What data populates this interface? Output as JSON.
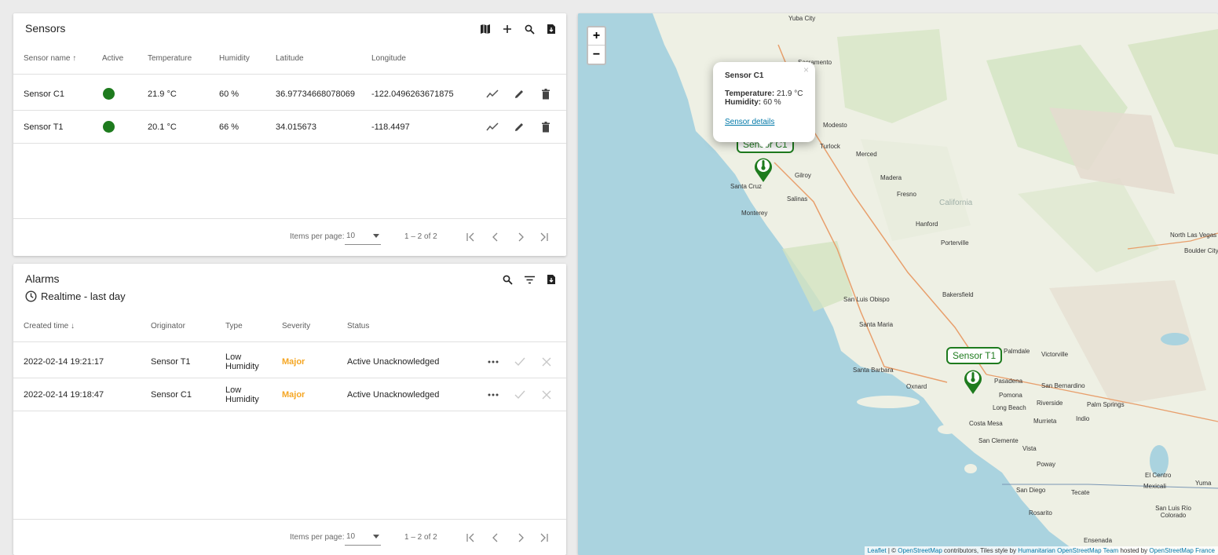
{
  "sensors": {
    "title": "Sensors",
    "toolbar_icons": [
      "map-icon",
      "add-icon",
      "search-icon",
      "export-icon"
    ],
    "columns": [
      "Sensor name",
      "Active",
      "Temperature",
      "Humidity",
      "Latitude",
      "Longitude"
    ],
    "sort_indicator": "↑",
    "rows": [
      {
        "name": "Sensor C1",
        "active": true,
        "temperature": "21.9 °C",
        "humidity": "60 %",
        "latitude": "36.97734668078069",
        "longitude": "-122.0496263671875"
      },
      {
        "name": "Sensor T1",
        "active": true,
        "temperature": "20.1 °C",
        "humidity": "66 %",
        "latitude": "34.015673",
        "longitude": "-118.4497"
      }
    ],
    "paginator": {
      "label": "Items per page:",
      "page_size": "10",
      "range": "1 – 2 of 2"
    }
  },
  "alarms": {
    "title": "Alarms",
    "timewindow": "Realtime - last day",
    "columns": [
      "Created time",
      "Originator",
      "Type",
      "Severity",
      "Status"
    ],
    "sort_indicator": "↓",
    "rows": [
      {
        "created": "2022-02-14 19:21:17",
        "originator": "Sensor T1",
        "type_line1": "Low",
        "type_line2": "Humidity",
        "severity": "Major",
        "status": "Active Unacknowledged"
      },
      {
        "created": "2022-02-14 19:18:47",
        "originator": "Sensor C1",
        "type_line1": "Low",
        "type_line2": "Humidity",
        "severity": "Major",
        "status": "Active Unacknowledged"
      }
    ],
    "paginator": {
      "label": "Items per page:",
      "page_size": "10",
      "range": "1 – 2 of 2"
    }
  },
  "map": {
    "zoom_in": "+",
    "zoom_out": "−",
    "popup": {
      "title": "Sensor C1",
      "temperature_label": "Temperature:",
      "temperature_value": "21.9 °C",
      "humidity_label": "Humidity:",
      "humidity_value": "60 %",
      "link": "Sensor details",
      "close": "×"
    },
    "markers": [
      {
        "label": "Sensor C1"
      },
      {
        "label": "Sensor T1"
      }
    ],
    "cities": [
      "Sacramento",
      "Modesto",
      "Turlock",
      "Merced",
      "Madera",
      "Fresno",
      "Gilroy",
      "Santa Cruz",
      "Salinas",
      "Monterey",
      "Hanford",
      "Porterville",
      "San Luis Obispo",
      "Santa Maria",
      "Bakersfield",
      "Santa Barbara",
      "Oxnard",
      "Palmdale",
      "Victorville",
      "Pasadena",
      "San Bernardino",
      "Pomona",
      "Riverside",
      "Long Beach",
      "Palm Springs",
      "Costa Mesa",
      "Murrieta",
      "Indio",
      "San Clemente",
      "Vista",
      "Poway",
      "San Diego",
      "Tecate",
      "Rosarito",
      "Ensenada",
      "El Centro",
      "Mexicali",
      "Yuma",
      "San Luis Río Colorado",
      "North Las Vegas",
      "Boulder City",
      "Yuba City",
      "California"
    ],
    "attribution": {
      "leaflet": "Leaflet",
      "osm_prefix": "| ©",
      "osm": "OpenStreetMap",
      "middle": "contributors, Tiles style by",
      "hot": "Humanitarian OpenStreetMap Team",
      "hosted": "hosted by",
      "osm_france": "OpenStreetMap France"
    },
    "colors": {
      "water": "#aad3df",
      "land": "#f2efe9",
      "marker": "#1e7b1e"
    }
  }
}
